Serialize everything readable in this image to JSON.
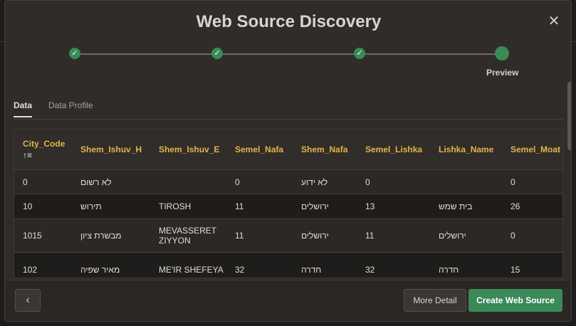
{
  "dialog": {
    "title": "Web Source Discovery",
    "close_icon": "close-icon"
  },
  "train": {
    "steps": [
      {
        "icon": "check-icon",
        "label": "",
        "state": "complete"
      },
      {
        "icon": "check-icon",
        "label": "",
        "state": "complete"
      },
      {
        "icon": "check-icon",
        "label": "",
        "state": "complete"
      },
      {
        "icon": "",
        "label": "Preview",
        "state": "current"
      }
    ],
    "check_glyph": "✓"
  },
  "tabs": [
    {
      "label": "Data",
      "active": true
    },
    {
      "label": "Data Profile",
      "active": false
    }
  ],
  "grid": {
    "sort_glyph": "↑≡",
    "columns": [
      "City_Code",
      "Shem_Ishuv_H",
      "Shem_Ishuv_E",
      "Semel_Nafa",
      "Shem_Nafa",
      "Semel_Lishka",
      "Lishka_Name",
      "Semel_Moat"
    ],
    "rows": [
      [
        "0",
        "לא רשום",
        "",
        "0",
        "לא ידוע",
        "0",
        "",
        "0"
      ],
      [
        "10",
        "תירוש",
        "TIROSH",
        "11",
        "ירושלים",
        "13",
        "בית שמש",
        "26"
      ],
      [
        "1015",
        "מבשרת ציון",
        "MEVASSERET ZIYYON",
        "11",
        "ירושלים",
        "11",
        "ירושלים",
        "0"
      ],
      [
        "102",
        "מאיר שפיה",
        "ME'IR SHEFEYA",
        "32",
        "חדרה",
        "32",
        "חדרה",
        "15"
      ]
    ]
  },
  "footer": {
    "back_icon": "chevron-left-icon",
    "back_glyph": "‹",
    "more_detail_label": "More Detail",
    "create_label": "Create Web Source"
  },
  "colors": {
    "accent_green": "#3a8a58",
    "header_text": "#e3b44a",
    "dialog_bg": "#2f2c29"
  }
}
